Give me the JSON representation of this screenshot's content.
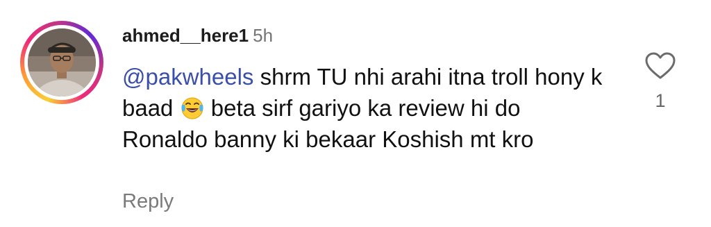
{
  "comment": {
    "username": "ahmed__here1",
    "time": "5h",
    "mention": "@pakwheels",
    "text_part1": " shrm TU nhi arahi itna troll hony k baad ",
    "emoji_icon": "face-with-tears-of-joy-icon",
    "text_part2": " beta sirf gariyo ka review hi do Ronaldo banny ki bekaar Koshish mt kro",
    "reply_label": "Reply",
    "like_count": "1"
  },
  "colors": {
    "mention": "#3a4fa8",
    "username": "#1c1c1c",
    "muted": "#7a7a7a"
  }
}
